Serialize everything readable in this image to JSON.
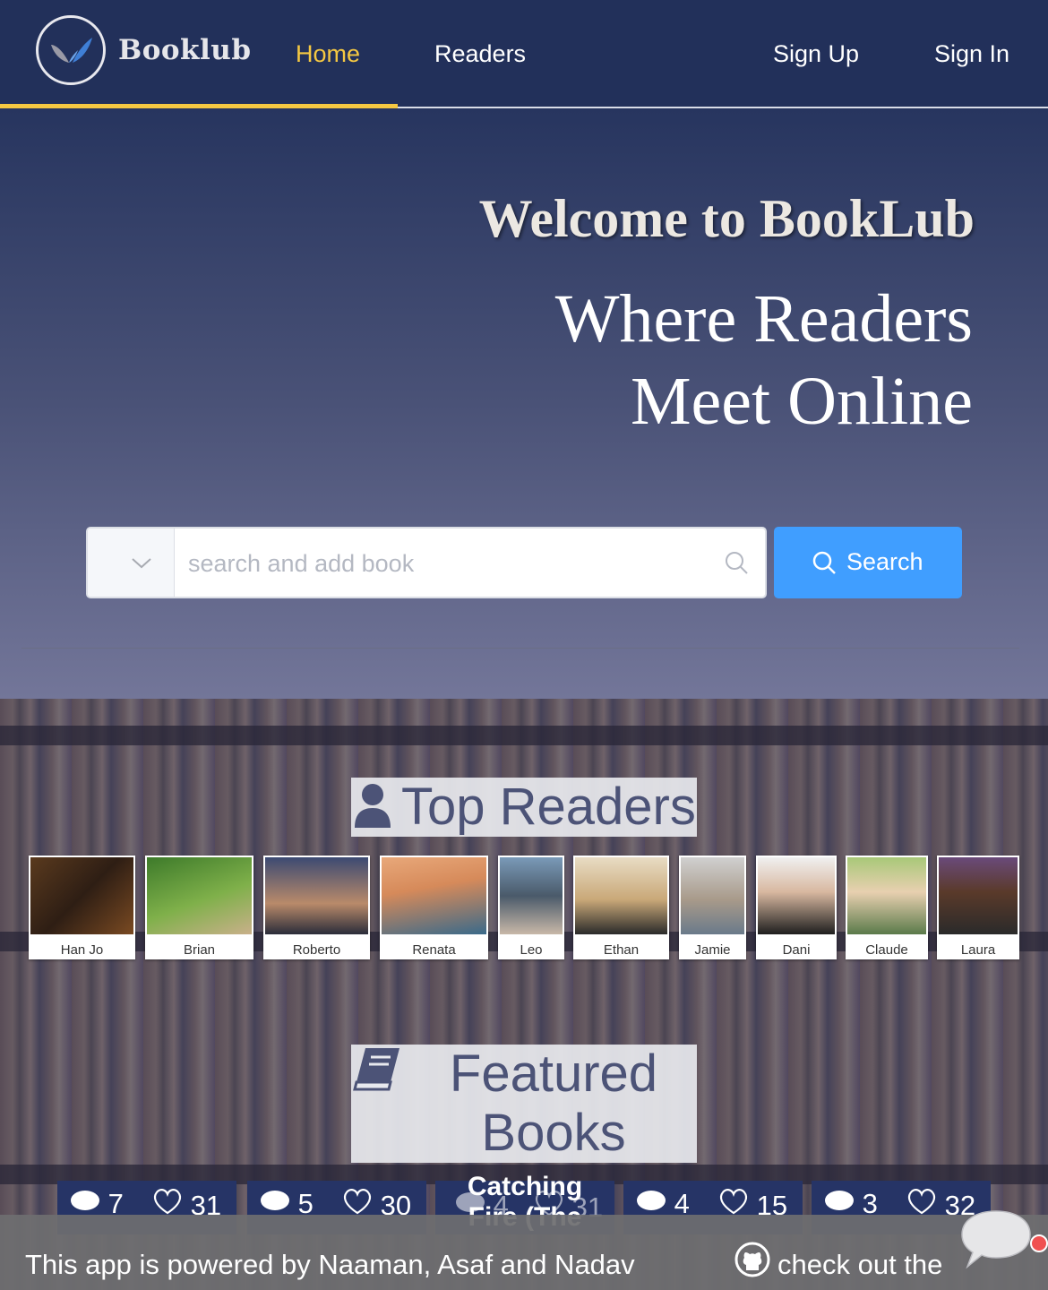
{
  "nav": {
    "logo_text": "Booklub",
    "links": [
      {
        "label": "Home",
        "active": true
      },
      {
        "label": "Readers",
        "active": false
      },
      {
        "label": "Sign Up",
        "active": false
      },
      {
        "label": "Sign In",
        "active": false
      }
    ],
    "accent_color": "#f5c842",
    "background_color": "#22305a"
  },
  "hero": {
    "welcome": "Welcome to BookLub",
    "tagline_line1": "Where Readers",
    "tagline_line2": "Meet Online"
  },
  "search": {
    "placeholder": "search and add book",
    "value": "",
    "button_label": "Search",
    "button_color": "#409eff"
  },
  "top_readers": {
    "title": "Top Readers",
    "icon": "user-icon",
    "readers": [
      {
        "name": "Han Jo"
      },
      {
        "name": "Brian"
      },
      {
        "name": "Roberto"
      },
      {
        "name": "Renata"
      },
      {
        "name": "Leo"
      },
      {
        "name": "Ethan"
      },
      {
        "name": "Jamie"
      },
      {
        "name": "Dani"
      },
      {
        "name": "Claude"
      },
      {
        "name": "Laura"
      }
    ]
  },
  "featured_books": {
    "title": "Featured Books",
    "icon": "book-icon",
    "books": [
      {
        "comments": "7",
        "likes": "31"
      },
      {
        "comments": "5",
        "likes": "30"
      },
      {
        "title_partial": "Catching Fire (The",
        "comments": "4",
        "likes": "31"
      },
      {
        "comments": "4",
        "likes": "15"
      },
      {
        "comments": "3",
        "likes": "32"
      }
    ]
  },
  "footer": {
    "credit": "This app is powered by Naaman, Asaf and Nadav",
    "link": "check out the",
    "link_icon": "github-icon",
    "chat_icon": "chat-bubble-icon"
  }
}
